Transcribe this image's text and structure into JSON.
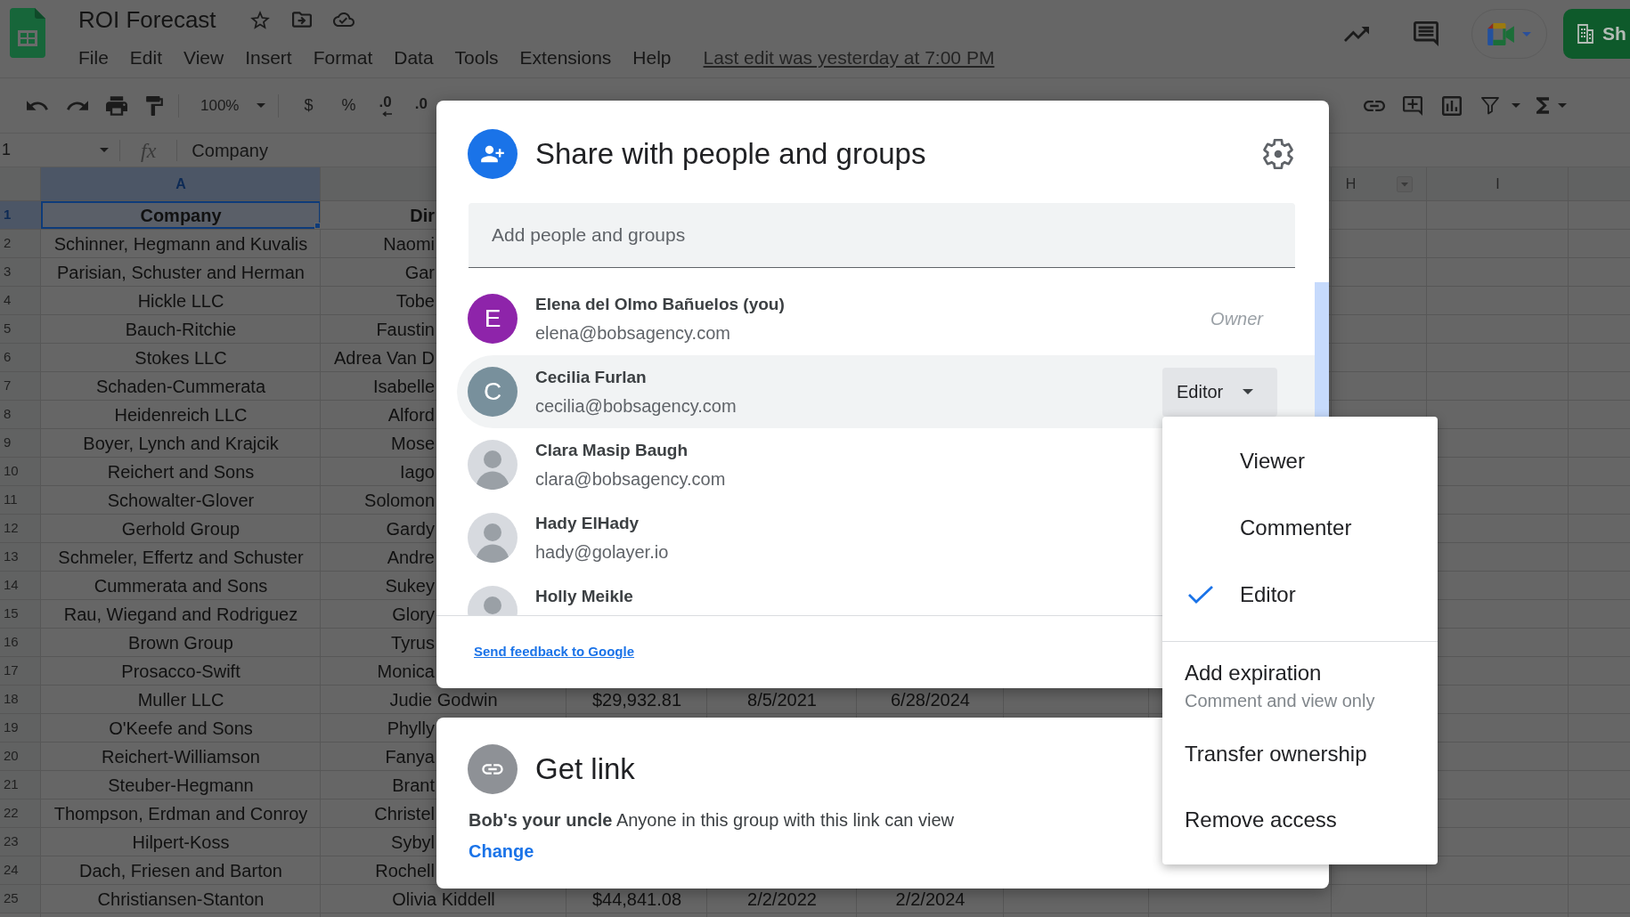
{
  "app": {
    "title": "ROI Forecast",
    "last_edit": "Last edit was yesterday at 7:00 PM",
    "share_label": "Sh"
  },
  "menu_bar": [
    "File",
    "Edit",
    "View",
    "Insert",
    "Format",
    "Data",
    "Tools",
    "Extensions",
    "Help"
  ],
  "toolbar": {
    "zoom": "100%",
    "currency": "$",
    "percent": "%",
    "decrease_decimal": ".0",
    "increase_decimal": ".0"
  },
  "formula_bar": {
    "cell_reference": "1",
    "function_label": "fx",
    "value": "Company"
  },
  "sheet": {
    "columns": [
      {
        "label": "A",
        "selected": true,
        "filter": false
      },
      {
        "label": "H",
        "selected": false,
        "filter": true
      },
      {
        "label": "I",
        "selected": false,
        "filter": false
      }
    ],
    "rows": [
      {
        "number": "1",
        "kind": "header",
        "selected": true,
        "cells": [
          "Company",
          "Dir"
        ]
      },
      {
        "number": "2",
        "kind": "data",
        "selected": false,
        "cells": [
          "Schinner, Hegmann and Kuvalis",
          "Naomi"
        ]
      },
      {
        "number": "3",
        "kind": "data",
        "selected": false,
        "cells": [
          "Parisian, Schuster and Herman",
          "Gar"
        ]
      },
      {
        "number": "4",
        "kind": "data",
        "selected": false,
        "cells": [
          "Hickle LLC",
          "Tobe"
        ]
      },
      {
        "number": "5",
        "kind": "data",
        "selected": false,
        "cells": [
          "Bauch-Ritchie",
          "Faustin"
        ]
      },
      {
        "number": "6",
        "kind": "data",
        "selected": false,
        "cells": [
          "Stokes LLC",
          "Adrea Van D"
        ]
      },
      {
        "number": "7",
        "kind": "data",
        "selected": false,
        "cells": [
          "Schaden-Cummerata",
          "Isabelle"
        ]
      },
      {
        "number": "8",
        "kind": "data",
        "selected": false,
        "cells": [
          "Heidenreich LLC",
          "Alford"
        ]
      },
      {
        "number": "9",
        "kind": "data",
        "selected": false,
        "cells": [
          "Boyer, Lynch and Krajcik",
          "Mose"
        ]
      },
      {
        "number": "10",
        "kind": "data",
        "selected": false,
        "cells": [
          "Reichert and Sons",
          "Iago"
        ]
      },
      {
        "number": "11",
        "kind": "data",
        "selected": false,
        "cells": [
          "Schowalter-Glover",
          "Solomon"
        ]
      },
      {
        "number": "12",
        "kind": "data",
        "selected": false,
        "cells": [
          "Gerhold Group",
          "Gardy"
        ]
      },
      {
        "number": "13",
        "kind": "data",
        "selected": false,
        "cells": [
          "Schmeler, Effertz and Schuster",
          "Andre"
        ]
      },
      {
        "number": "14",
        "kind": "data",
        "selected": false,
        "cells": [
          "Cummerata and Sons",
          "Sukey"
        ]
      },
      {
        "number": "15",
        "kind": "data",
        "selected": false,
        "cells": [
          "Rau, Wiegand and Rodriguez",
          "Glory"
        ]
      },
      {
        "number": "16",
        "kind": "data",
        "selected": false,
        "cells": [
          "Brown Group",
          "Tyrus"
        ]
      },
      {
        "number": "17",
        "kind": "data",
        "selected": false,
        "cells": [
          "Prosacco-Swift",
          "Monica"
        ]
      },
      {
        "number": "18",
        "kind": "data",
        "selected": false,
        "cells": [
          "Muller LLC",
          "Judie Godwin",
          "$29,932.81",
          "8/5/2021",
          "6/28/2024"
        ]
      },
      {
        "number": "19",
        "kind": "data",
        "selected": false,
        "cells": [
          "O'Keefe and Sons",
          "Phylly"
        ]
      },
      {
        "number": "20",
        "kind": "data",
        "selected": false,
        "cells": [
          "Reichert-Williamson",
          "Fanya"
        ]
      },
      {
        "number": "21",
        "kind": "data",
        "selected": false,
        "cells": [
          "Steuber-Hegmann",
          "Brant"
        ]
      },
      {
        "number": "22",
        "kind": "data",
        "selected": false,
        "cells": [
          "Thompson, Erdman and Conroy",
          "Christel"
        ]
      },
      {
        "number": "23",
        "kind": "data",
        "selected": false,
        "cells": [
          "Hilpert-Koss",
          "Sybyl"
        ]
      },
      {
        "number": "24",
        "kind": "data",
        "selected": false,
        "cells": [
          "Dach, Friesen and Barton",
          "Rochell"
        ]
      },
      {
        "number": "25",
        "kind": "data",
        "selected": false,
        "cells": [
          "Christiansen-Stanton",
          "Olivia Kiddell",
          "$44,841.08",
          "2/2/2022",
          "2/2/2024"
        ]
      }
    ]
  },
  "share_dialog": {
    "title": "Share with people and groups",
    "search": {
      "placeholder": "Add people and groups"
    },
    "people": [
      {
        "name": "Elena del Olmo Bañuelos (you)",
        "email": "elena@bobsagency.com",
        "avatar": {
          "kind": "letter",
          "letter": "E",
          "color": "#8e24aa"
        },
        "role": {
          "kind": "label",
          "text": "Owner"
        },
        "selected": false
      },
      {
        "name": "Cecilia Furlan",
        "email": "cecilia@bobsagency.com",
        "avatar": {
          "kind": "letter",
          "letter": "C",
          "color": "#78909c"
        },
        "role": {
          "kind": "dropdown",
          "text": "Editor"
        },
        "selected": true
      },
      {
        "name": "Clara Masip Baugh",
        "email": "clara@bobsagency.com",
        "avatar": {
          "kind": "photo"
        },
        "selected": false
      },
      {
        "name": "Hady ElHady",
        "email": "hady@golayer.io",
        "avatar": {
          "kind": "photo"
        },
        "selected": false
      },
      {
        "name": "Holly Meikle",
        "avatar": {
          "kind": "photo"
        },
        "selected": false
      }
    ],
    "feedback_link": "Send feedback to Google"
  },
  "get_link": {
    "title": "Get link",
    "description": "**Bob's your uncle** Anyone in this group with this link can view",
    "change_link": "Change"
  },
  "role_menu": {
    "roles": [
      {
        "label": "Viewer",
        "selected": false
      },
      {
        "label": "Commenter",
        "selected": false
      },
      {
        "label": "Editor",
        "selected": true
      }
    ],
    "actions": [
      {
        "label": "Add expiration",
        "note": "Comment and view only"
      },
      {
        "label": "Transfer ownership"
      },
      {
        "label": "Remove access"
      }
    ]
  }
}
